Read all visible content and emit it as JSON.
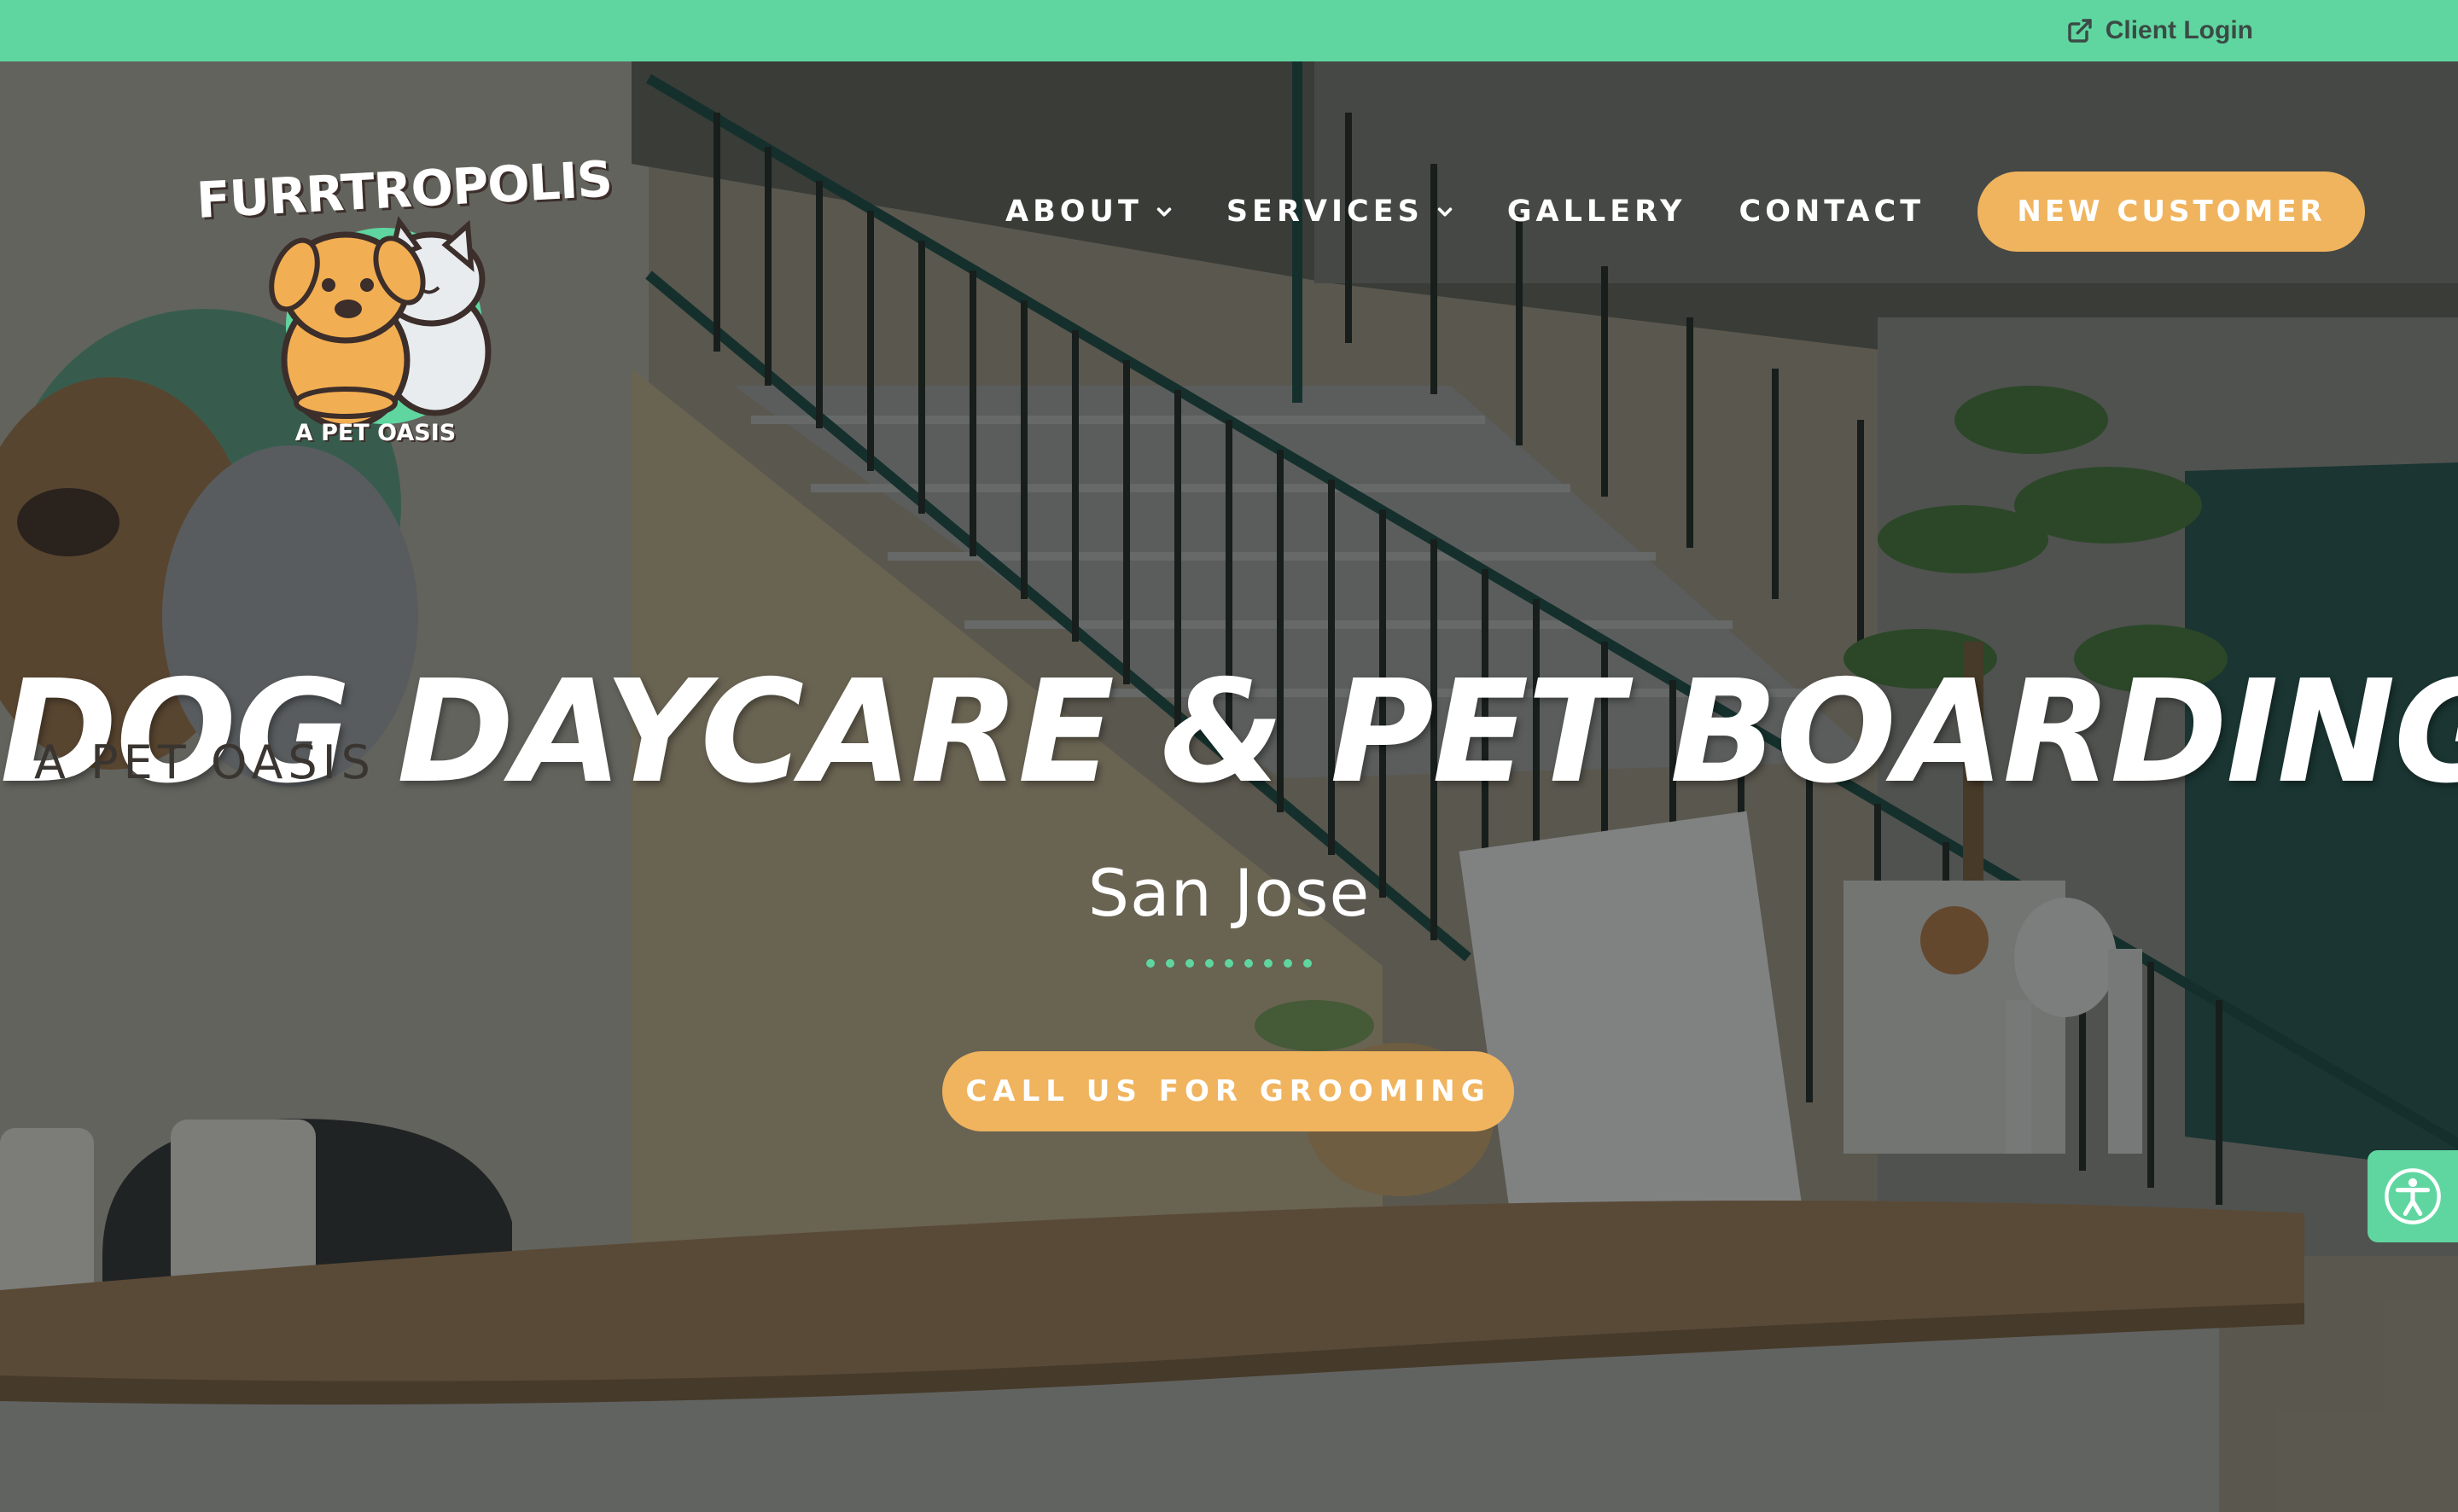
{
  "topbar": {
    "client_login_label": "Client Login",
    "client_login_icon": "external-link-icon",
    "background_color": "#5fd6a0"
  },
  "logo": {
    "name": "FURRTROPOLIS",
    "tagline": "A PET OASIS"
  },
  "nav": {
    "items": [
      {
        "label": "ABOUT",
        "has_dropdown": true
      },
      {
        "label": "SERVICES",
        "has_dropdown": true
      },
      {
        "label": "GALLERY",
        "has_dropdown": false
      },
      {
        "label": "CONTACT",
        "has_dropdown": false
      }
    ],
    "cta_label": "NEW CUSTOMER"
  },
  "hero": {
    "headline": "DOG DAYCARE & PET BOARDING",
    "subheadline": "San Jose",
    "cta_label": "CALL US FOR GROOMING",
    "wall_sign_text": "A PET OASIS",
    "accent_color": "#f0b45e"
  },
  "accessibility": {
    "icon": "accessibility-icon"
  }
}
